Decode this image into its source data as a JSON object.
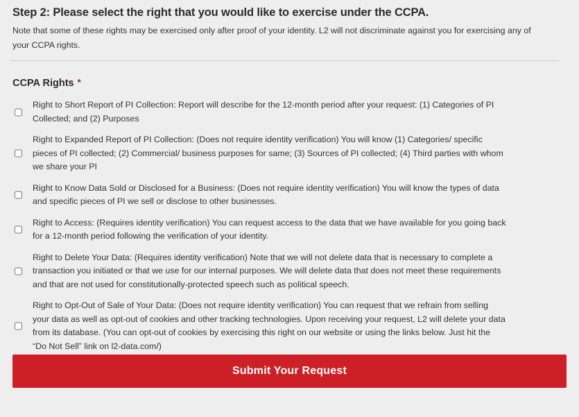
{
  "colors": {
    "background": "#eeeeee",
    "text": "#333333",
    "heading": "#2b2b2b",
    "required_star": "#8b2331",
    "submit_button": "#cd2026",
    "submit_button_text": "#ffffff",
    "divider": "#cccccc",
    "checkbox_border": "#9a9a9a"
  },
  "header": {
    "step_heading": "Step 2: Please select the right that you would like to exercise under the CCPA.",
    "intro_note": "Note that some of these rights may be exercised only after proof of your identity. L2 will not discriminate against you for exercising any of your CCPA rights."
  },
  "form": {
    "field_label": "CCPA Rights",
    "required_marker": "*",
    "options": [
      {
        "id": "short-report",
        "label": "Right to Short Report of PI Collection: Report will describe for the 12-month period after your request: (1) Categories of PI Collected; and (2) Purposes",
        "checked": false
      },
      {
        "id": "expanded-report",
        "label": "Right to Expanded Report of PI Collection: (Does not require identity verification) You will know (1) Categories/ specific pieces of PI collected; (2) Commercial/ business purposes for same; (3) Sources of PI collected; (4) Third parties with whom we share your PI",
        "checked": false
      },
      {
        "id": "know-data-sold",
        "label": "Right to Know Data Sold or Disclosed for a Business: (Does not require identity verification) You will know the types of data and specific pieces of PI we sell or disclose to other businesses.",
        "checked": false
      },
      {
        "id": "access",
        "label": "Right to Access: (Requires identity verification) You can request access to the data that we have available for you going back for a 12-month period following the verification of your identity.",
        "checked": false
      },
      {
        "id": "delete",
        "label": "Right to Delete Your Data: (Requires identity verification) Note that we will not delete data that is necessary to complete a transaction you initiated or that we use for our internal purposes. We will delete data that does not meet these requirements and that are not used for constitutionally-protected speech such as political speech.",
        "checked": false
      },
      {
        "id": "opt-out-of-sale",
        "label": "Right to Opt-Out of Sale of Your Data: (Does not require identity verification) You can request that we refrain from selling your data as well as opt-out of cookies and other tracking technologies. Upon receiving your request, L2 will delete your data from its database. (You can opt-out of cookies by exercising this right on our website or using the links below. Just hit the “Do Not Sell” link on l2-data.com/)",
        "checked": false
      }
    ],
    "submit_label": "Submit Your Request"
  }
}
